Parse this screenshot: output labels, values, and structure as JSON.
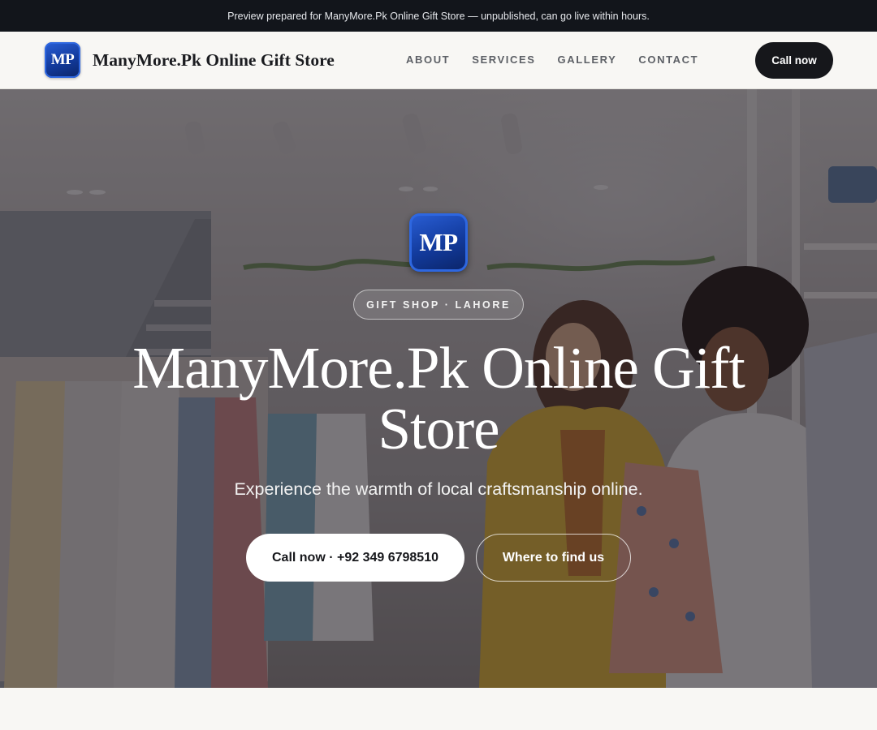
{
  "preview_banner": {
    "text": "Preview prepared for ManyMore.Pk Online Gift Store — unpublished, can go live within hours."
  },
  "header": {
    "logo_text": "MP",
    "brand_name": "ManyMore.Pk Online Gift Store",
    "nav": [
      "ABOUT",
      "SERVICES",
      "GALLERY",
      "CONTACT"
    ],
    "cta_label": "Call now"
  },
  "hero": {
    "logo_text": "MP",
    "eyebrow": "GIFT SHOP · LAHORE",
    "title": "ManyMore.Pk Online Gift Store",
    "subtitle": "Experience the warmth of local craftsmanship online.",
    "primary_cta": "Call now · +92 349 6798510",
    "secondary_cta": "Where to find us"
  },
  "colors": {
    "preview_bar": "#12151b",
    "page_bg": "#f8f7f4",
    "logo_blue": "#123a9c",
    "dark_button": "#16171b"
  },
  "icons": {
    "logo": "mp-monogram-logo"
  }
}
